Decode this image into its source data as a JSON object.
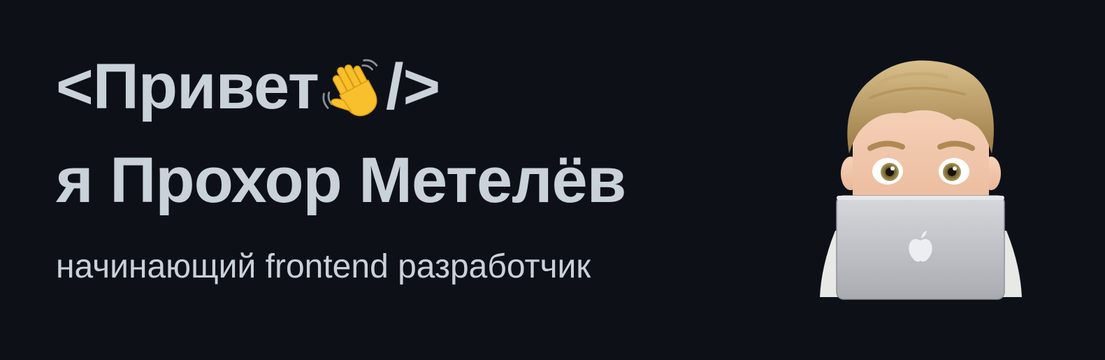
{
  "greeting": {
    "open": "<Привет",
    "close": "/>",
    "emoji_icon": "waving-hand-icon"
  },
  "name_line": "я Прохор Метелёв",
  "role": "начинающий frontend разработчик",
  "colors": {
    "background": "#0d1117",
    "text": "#c9d1d9"
  },
  "avatar_icon": "memoji-laptop-avatar"
}
